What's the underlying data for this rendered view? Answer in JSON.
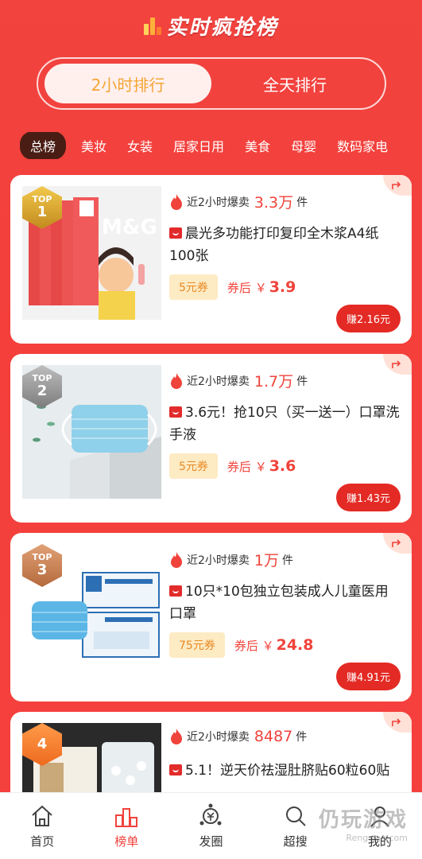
{
  "header": {
    "title": "实时疯抢榜"
  },
  "range": {
    "options": [
      "2小时排行",
      "全天排行"
    ],
    "active": 0
  },
  "categories": [
    "总榜",
    "美妆",
    "女装",
    "居家日用",
    "美食",
    "母婴",
    "数码家电"
  ],
  "sales_prefix": "近2小时爆卖",
  "unit": "件",
  "after_label": "券后 ￥",
  "products": [
    {
      "rank_label": "TOP",
      "rank": "1",
      "sales": "3.3万",
      "title": "晨光多功能打印复印全木浆A4纸100张",
      "coupon": "5元券",
      "price": "3.9",
      "earn": "赚2.16元"
    },
    {
      "rank_label": "TOP",
      "rank": "2",
      "sales": "1.7万",
      "title": "3.6元！抢10只（买一送一）口罩洗手液",
      "coupon": "5元券",
      "price": "3.6",
      "earn": "赚1.43元"
    },
    {
      "rank_label": "TOP",
      "rank": "3",
      "sales": "1万",
      "title": "10只*10包独立包装成人儿童医用口罩",
      "coupon": "75元券",
      "price": "24.8",
      "earn": "赚4.91元"
    },
    {
      "rank_label": "",
      "rank": "4",
      "sales": "8487",
      "title": "5.1！逆天价祛湿肚脐贴60粒60贴"
    }
  ],
  "tabs": [
    "首页",
    "榜单",
    "发圈",
    "超搜",
    "我的"
  ],
  "watermark": {
    "main": "仍玩游戏",
    "sub": "Rengwan.com"
  },
  "colors": {
    "accent": "#f0433b",
    "coupon_bg": "#fdebc4",
    "coupon_text": "#e98a24",
    "earn_bg": "#e42a24"
  }
}
